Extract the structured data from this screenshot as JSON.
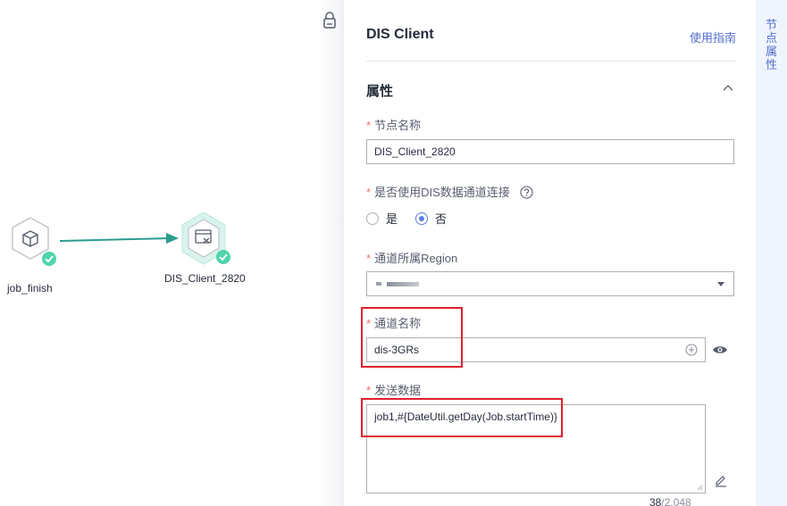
{
  "canvas": {
    "nodes": [
      {
        "label": "job_finish"
      },
      {
        "label": "DIS_Client_2820"
      }
    ]
  },
  "panel": {
    "title": "DIS Client",
    "guide_link": "使用指南",
    "section_title": "属性",
    "fields": {
      "node_name": {
        "label": "节点名称",
        "value": "DIS_Client_2820"
      },
      "use_channel": {
        "label": "是否使用DIS数据通道连接",
        "options": [
          "是",
          "否"
        ],
        "selected": "否"
      },
      "region": {
        "label": "通道所属Region"
      },
      "channel_name": {
        "label": "通道名称",
        "value": "dis-3GRs"
      },
      "send_data": {
        "label": "发送数据",
        "value": "job1,#{DateUtil.getDay(Job.startTime)}",
        "count": "38",
        "max": "/2,048"
      }
    }
  },
  "right_tab": {
    "chars": [
      "节",
      "点",
      "属",
      "性"
    ]
  },
  "colors": {
    "accent": "#5e7ce0",
    "link": "#526ecc",
    "required": "#f66f6a",
    "success": "#50d4ab",
    "edge": "#2a9d8f",
    "highlight": "#e0202f"
  },
  "icons": {
    "job_finish": "cube-icon",
    "dis_client": "dis-client-icon",
    "status": "check-badge-icon",
    "lock": "lock-icon",
    "collapse": "chevron-up-icon",
    "help": "help-icon",
    "add": "plus-circle-icon",
    "view": "eye-icon",
    "edit": "pencil-icon",
    "dropdown": "caret-down-icon"
  }
}
